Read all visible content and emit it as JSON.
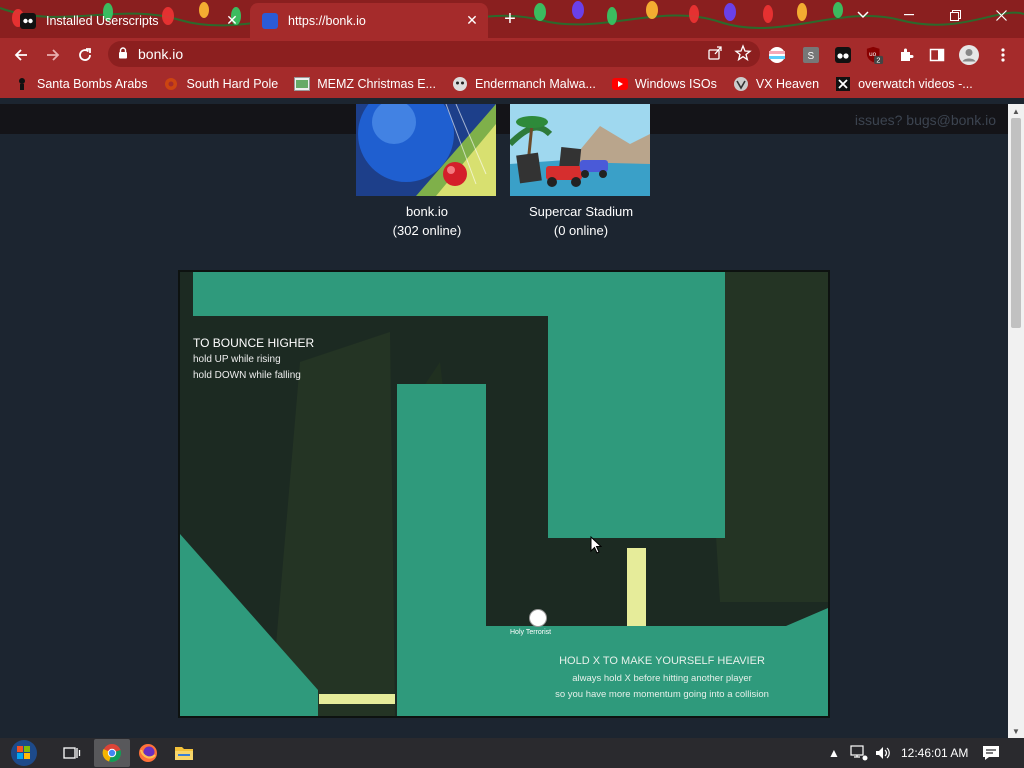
{
  "tabs": [
    {
      "title": "Installed Userscripts",
      "active": false
    },
    {
      "title": "https://bonk.io",
      "active": true
    }
  ],
  "toolbar": {
    "url": "bonk.io"
  },
  "bookmarks": [
    {
      "label": "Santa Bombs Arabs",
      "icon": "bookmark-icon"
    },
    {
      "label": "South Hard Pole",
      "icon": "bookmark-icon"
    },
    {
      "label": "MEMZ Christmas E...",
      "icon": "bookmark-icon"
    },
    {
      "label": "Endermanch Malwa...",
      "icon": "bookmark-icon"
    },
    {
      "label": "Windows ISOs",
      "icon": "youtube-icon"
    },
    {
      "label": "VX Heaven",
      "icon": "bookmark-icon"
    },
    {
      "label": "overwatch videos -...",
      "icon": "x-icon"
    }
  ],
  "page": {
    "issues_text": "issues? bugs@bonk.io",
    "games": [
      {
        "name": "bonk.io",
        "online": "(302 online)"
      },
      {
        "name": "Supercar Stadium",
        "online": "(0 online)"
      }
    ],
    "game_canvas": {
      "hint1_title": "TO BOUNCE HIGHER",
      "hint1_line1": "hold UP while rising",
      "hint1_line2": "hold DOWN while falling",
      "player_name": "Holy Terrorist",
      "hint2_title": "HOLD X TO MAKE YOURSELF HEAVIER",
      "hint2_line1": "always hold X before hitting another player",
      "hint2_line2": "so you have more momentum going into a collision"
    }
  },
  "taskbar": {
    "time": "12:46:01 AM"
  },
  "colors": {
    "chrome_red": "#a52b2b",
    "page_bg": "#1c2530",
    "platform_green": "#2f9a7c",
    "pad_yellow": "#e6ec9a"
  }
}
